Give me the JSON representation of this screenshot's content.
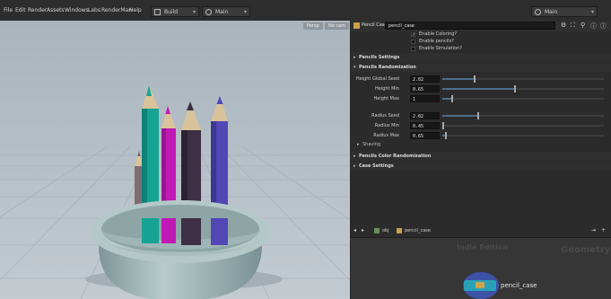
{
  "menubar": {
    "items": [
      "File",
      "Edit",
      "Render",
      "Assets",
      "Windows",
      "Labs",
      "RenderMan",
      "Help"
    ],
    "desktop_combo": "Build",
    "context_combo": "Main",
    "right_combo": "Main"
  },
  "viewport": {
    "camera_button": "Persp",
    "cam_button": "No cam"
  },
  "params": {
    "node_type": "Pencil Case",
    "node_name": "pencil_case",
    "checkboxes": [
      {
        "label": "Enable Coloring?",
        "checked": true
      },
      {
        "label": "Enable pencils?",
        "checked": false
      },
      {
        "label": "Enable Simulation?",
        "checked": false
      }
    ],
    "sections": {
      "pencil_settings": "Pencils Settings",
      "pencil_randomization": "Pencils Randomization",
      "shaving": "Shaving",
      "color_randomization": "Pencils Color Randomization",
      "case_settings": "Case Settings"
    },
    "fields": [
      {
        "label": "Height Global Seed",
        "value": "2.02",
        "slider": 0.2
      },
      {
        "label": "Height Min",
        "value": "0.65",
        "slider": 0.45
      },
      {
        "label": "Height Max",
        "value": "1",
        "slider": 0.06
      },
      {
        "label": "Radius Seed",
        "value": "2.02",
        "slider": 0.22
      },
      {
        "label": "Radius Min",
        "value": "0.45",
        "slider": 0.0
      },
      {
        "label": "Radius Max",
        "value": "0.65",
        "slider": 0.02
      }
    ]
  },
  "network": {
    "path_obj": "obj",
    "path_node": "pencil_case",
    "watermark_left": "Indie Edition",
    "watermark_right": "Geometry",
    "node_label": "pencil_case"
  },
  "colors": {
    "viewport_bg": "#b9c2c9",
    "panel_bg": "#2b2b2b",
    "accent_blue": "#4c6d8a",
    "node_color": "#2aa1b8"
  }
}
